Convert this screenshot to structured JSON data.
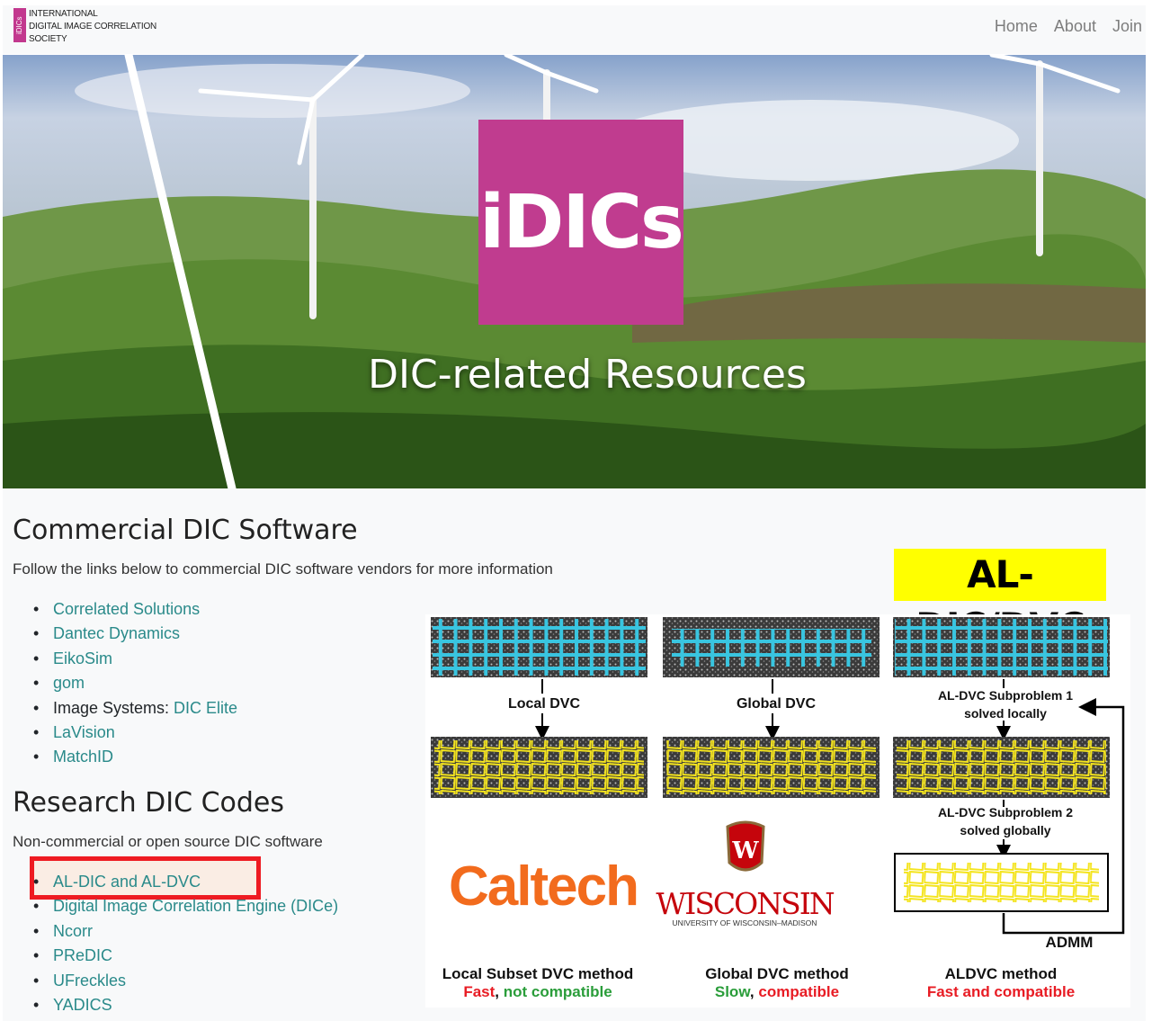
{
  "header": {
    "logo_mark": "iDICs",
    "logo_line1": "INTERNATIONAL",
    "logo_line2": "DIGITAL IMAGE CORRELATION",
    "logo_line3": "SOCIETY",
    "nav": [
      "Home",
      "About",
      "Join"
    ]
  },
  "hero": {
    "badge": "iDICs",
    "title": "DIC-related Resources"
  },
  "commercial": {
    "heading": "Commercial DIC Software",
    "lead": "Follow the links below to commercial DIC software vendors for more information",
    "items": [
      {
        "prefix": "",
        "link": "Correlated Solutions"
      },
      {
        "prefix": "",
        "link": "Dantec Dynamics"
      },
      {
        "prefix": "",
        "link": "EikoSim"
      },
      {
        "prefix": "",
        "link": "gom"
      },
      {
        "prefix": "Image Systems: ",
        "link": "DIC Elite"
      },
      {
        "prefix": "",
        "link": "LaVision"
      },
      {
        "prefix": "",
        "link": "MatchID"
      }
    ]
  },
  "research": {
    "heading": "Research DIC Codes",
    "lead": "Non-commercial or open source DIC software",
    "items": [
      "AL-DIC and AL-DVC",
      "Digital Image Correlation Engine (DICe)",
      "Ncorr",
      "PReDIC",
      "UFreckles",
      "YADICS"
    ]
  },
  "figure": {
    "badge": "AL-DIC/DVC",
    "col1_label": "Local DVC",
    "col2_label": "Global DVC",
    "col3_label1a": "AL-DVC Subproblem 1",
    "col3_label1b": "solved locally",
    "col3_label2a": "AL-DVC Subproblem 2",
    "col3_label2b": "solved globally",
    "admm": "ADMM",
    "caltech": "Caltech",
    "wisconsin": "WISCONSIN",
    "wisconsin_sub": "UNIVERSITY OF WISCONSIN–MADISON",
    "cap1_title": "Local Subset DVC method",
    "cap1_a": "Fast",
    "cap1_sep": ", ",
    "cap1_b": "not compatible",
    "cap2_title": "Global DVC method",
    "cap2_a": "Slow",
    "cap2_sep": ", ",
    "cap2_b": "compatible",
    "cap3_title": "ALDVC method",
    "cap3_a": "Fast and compatible",
    "colors": {
      "red": "#e81c24",
      "green": "#2a9d3a",
      "brand": "#c03c8f",
      "link": "#2a8a8a",
      "grid_blue": "#39c5e0",
      "grid_yellow": "#f4e41e",
      "caltech_orange": "#f26b1d",
      "wisc_red": "#c5050c"
    }
  }
}
